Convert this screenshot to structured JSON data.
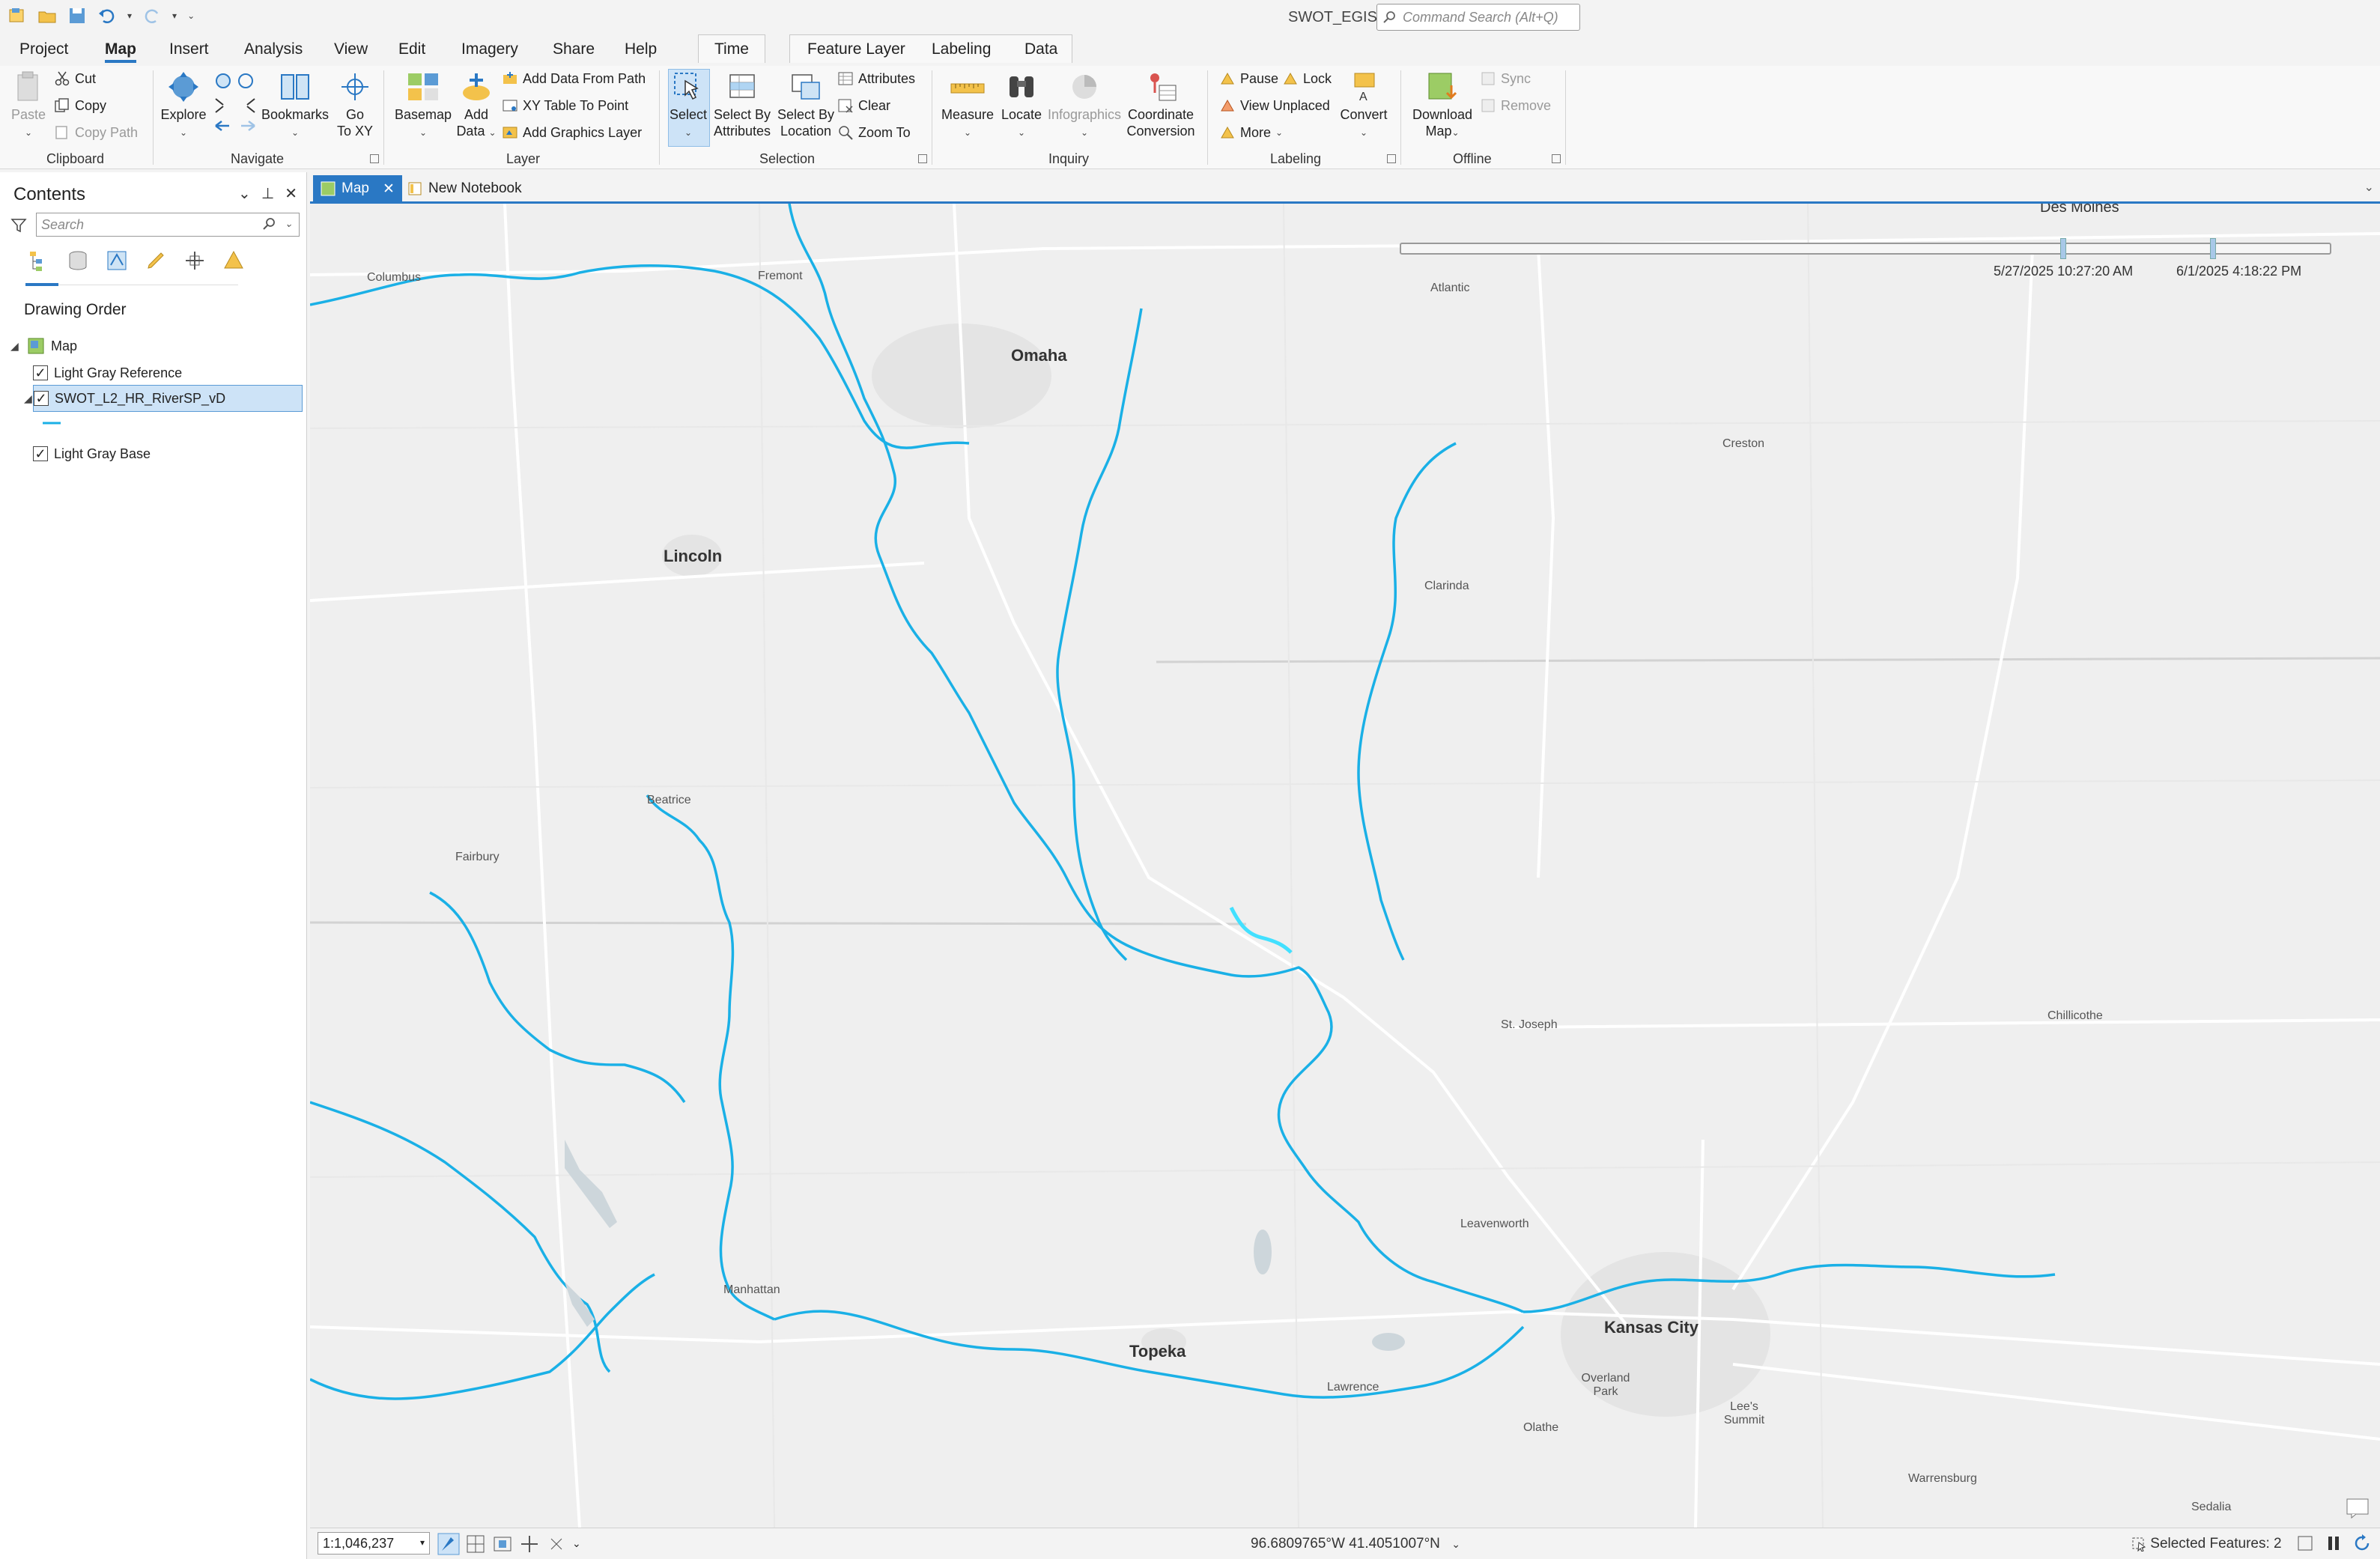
{
  "app": {
    "title": "SWOT_EGIS",
    "command_search_placeholder": "Command Search (Alt+Q)"
  },
  "ribbon_tabs": [
    {
      "label": "Project"
    },
    {
      "label": "Map",
      "active": true
    },
    {
      "label": "Insert"
    },
    {
      "label": "Analysis"
    },
    {
      "label": "View"
    },
    {
      "label": "Edit"
    },
    {
      "label": "Imagery"
    },
    {
      "label": "Share"
    },
    {
      "label": "Help"
    },
    {
      "label": "Time"
    },
    {
      "label": "Feature Layer"
    },
    {
      "label": "Labeling"
    },
    {
      "label": "Data"
    }
  ],
  "ribbon": {
    "clipboard": {
      "label": "Clipboard",
      "paste": "Paste",
      "cut": "Cut",
      "copy": "Copy",
      "copy_path": "Copy Path"
    },
    "navigate": {
      "label": "Navigate",
      "explore": "Explore",
      "bookmarks": "Bookmarks",
      "go_to_xy_1": "Go",
      "go_to_xy_2": "To XY"
    },
    "layer": {
      "label": "Layer",
      "basemap": "Basemap",
      "add_data_1": "Add",
      "add_data_2": "Data",
      "add_data_from_path": "Add Data From Path",
      "xy_table_to_point": "XY Table To Point",
      "add_graphics_layer": "Add Graphics Layer"
    },
    "selection": {
      "label": "Selection",
      "select": "Select",
      "select_by_attr_1": "Select By",
      "select_by_attr_2": "Attributes",
      "select_by_loc_1": "Select By",
      "select_by_loc_2": "Location",
      "attributes": "Attributes",
      "clear": "Clear",
      "zoom_to": "Zoom To"
    },
    "inquiry": {
      "label": "Inquiry",
      "measure": "Measure",
      "locate": "Locate",
      "infographics": "Infographics",
      "coord_conv_1": "Coordinate",
      "coord_conv_2": "Conversion"
    },
    "labeling": {
      "label": "Labeling",
      "pause": "Pause",
      "lock": "Lock",
      "view_unplaced": "View Unplaced",
      "more": "More",
      "convert": "Convert"
    },
    "offline": {
      "label": "Offline",
      "download_map_1": "Download",
      "download_map_2": "Map",
      "sync": "Sync",
      "remove": "Remove"
    }
  },
  "contents": {
    "title": "Contents",
    "search_placeholder": "Search",
    "drawing_order": "Drawing Order",
    "items": [
      {
        "label": "Map"
      },
      {
        "label": "Light Gray Reference"
      },
      {
        "label": "SWOT_L2_HR_RiverSP_vD"
      },
      {
        "label": "Light Gray Base"
      }
    ]
  },
  "view_tabs": [
    {
      "label": "Map"
    },
    {
      "label": "New Notebook"
    }
  ],
  "map": {
    "river_color": "#1ab0e6",
    "time_start": "5/27/2025 10:27:20 AM",
    "time_end": "6/1/2025 4:18:22 PM",
    "cities": {
      "columbus": "Columbus",
      "fremont": "Fremont",
      "omaha": "Omaha",
      "atlantic": "Atlantic",
      "des_moines": "Des Moines",
      "creston": "Creston",
      "lincoln": "Lincoln",
      "clarinda": "Clarinda",
      "beatrice": "Beatrice",
      "fairbury": "Fairbury",
      "st_joseph": "St. Joseph",
      "chillicothe": "Chillicothe",
      "leavenworth": "Leavenworth",
      "manhattan": "Manhattan",
      "topeka": "Topeka",
      "kansas_city": "Kansas City",
      "lawrence": "Lawrence",
      "overland_park": "Overland Park",
      "olathe": "Olathe",
      "lees_summit": "Lee's Summit",
      "warrensburg": "Warrensburg",
      "sedalia": "Sedalia"
    }
  },
  "status": {
    "scale": "1:1,046,237",
    "coordinates": "96.6809765°W 41.4051007°N",
    "selected_features": "Selected Features: 2"
  }
}
